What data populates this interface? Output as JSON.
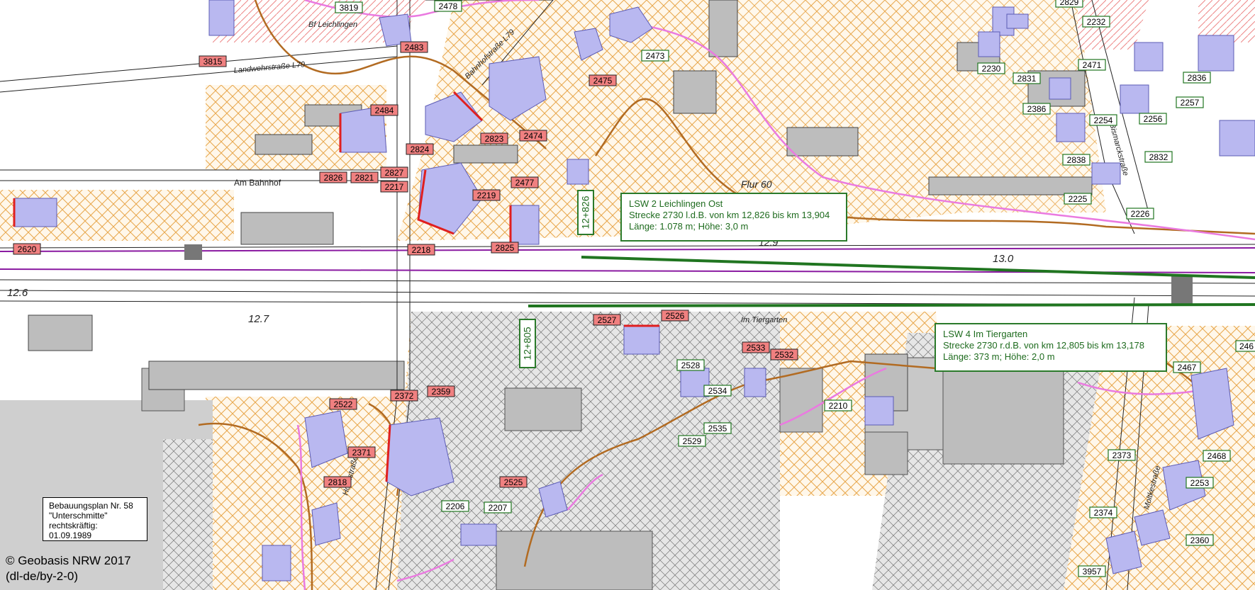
{
  "map": {
    "colors": {
      "hatch": "#e8a64b",
      "building": "#b9b8f0",
      "building_line": "#5c5cb5",
      "noise_wall": "#207520",
      "brown_line": "#b26b22",
      "pink_line": "#ea7ae0",
      "purple_rail": "#8a1aa1",
      "red_tag": "#f08080",
      "green_tag": "#ffffff",
      "gray_block": "#bdbdbd"
    },
    "place_labels": {
      "flur": "Flur 60",
      "am_bahnhof": "Am Bahnhof",
      "landwehr": "Landwehrstraße L79",
      "bahnhofstrasse": "Bahnhofstraße L79",
      "bf": "Bf Leichlingen",
      "im_tiergarten": "Im Tiergarten",
      "hochstrasse": "Hochstraße",
      "moltke": "Moltkestraße",
      "bismarck": "Bismarckstraße"
    },
    "km_markers": {
      "left": "12.6",
      "mid": "12.7",
      "right": "13.0",
      "center": "12.9"
    },
    "km_vertical": [
      {
        "label": "12+826"
      },
      {
        "label": "12+805"
      }
    ],
    "red_tags": [
      "3815",
      "2483",
      "2484",
      "2474",
      "2823",
      "2824",
      "2826",
      "2821",
      "2827",
      "2217",
      "2219",
      "2477",
      "2218",
      "2825",
      "2475",
      "2620",
      "2527",
      "2526",
      "2533",
      "2532",
      "2522",
      "2372",
      "2359",
      "2371",
      "2818",
      "2525"
    ],
    "green_tags": [
      "3819",
      "2478",
      "2473",
      "2829",
      "2232",
      "2230",
      "2831",
      "2386",
      "2471",
      "2836",
      "2257",
      "2256",
      "2254",
      "2832",
      "2838",
      "2225",
      "2226",
      "2528",
      "2534",
      "2535",
      "2529",
      "2210",
      "2206",
      "2207",
      "2467",
      "2468",
      "2373",
      "2253",
      "2374",
      "2360",
      "3957",
      "246"
    ]
  },
  "lsw2": {
    "title": "LSW 2 Leichlingen Ost",
    "line2": "Strecke 2730 l.d.B. von km 12,826 bis km 13,904",
    "line3": "Länge: 1.078 m; Höhe: 3,0 m"
  },
  "lsw4": {
    "title": "LSW 4 Im Tiergarten",
    "line2": "Strecke 2730 r.d.B. von km 12,805 bis km 13,178",
    "line3": "Länge: 373 m; Höhe: 2,0 m"
  },
  "bplan": {
    "line1": "Bebauungsplan Nr. 58",
    "line2": "\"Unterschmitte\"",
    "line3": "rechtskräftig: 01.09.1989"
  },
  "copyright": {
    "line1": "© Geobasis NRW 2017",
    "line2": "(dl-de/by-2-0)"
  }
}
